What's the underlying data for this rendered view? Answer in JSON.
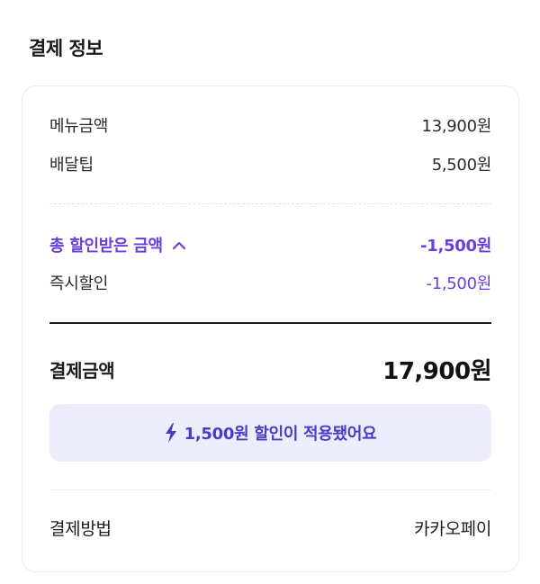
{
  "section": {
    "title": "결제 정보"
  },
  "rows": {
    "menu_amount": {
      "label": "메뉴금액",
      "value": "13,900원"
    },
    "delivery_tip": {
      "label": "배달팁",
      "value": "5,500원"
    },
    "total_discount": {
      "label": "총 할인받은 금액",
      "value": "-1,500원",
      "icon": "chevron-up-icon"
    },
    "instant_discount": {
      "label": "즉시할인",
      "value": "-1,500원"
    },
    "payment_total": {
      "label": "결제금액",
      "value": "17,900원"
    },
    "payment_method": {
      "label": "결제방법",
      "value": "카카오페이"
    }
  },
  "banner": {
    "text": "1,500원 할인이 적용됐어요",
    "icon": "lightning-bolt-icon"
  },
  "colors": {
    "accent": "#6b3ee0",
    "banner_bg": "#eeedfd",
    "banner_text": "#4a3bc4"
  }
}
